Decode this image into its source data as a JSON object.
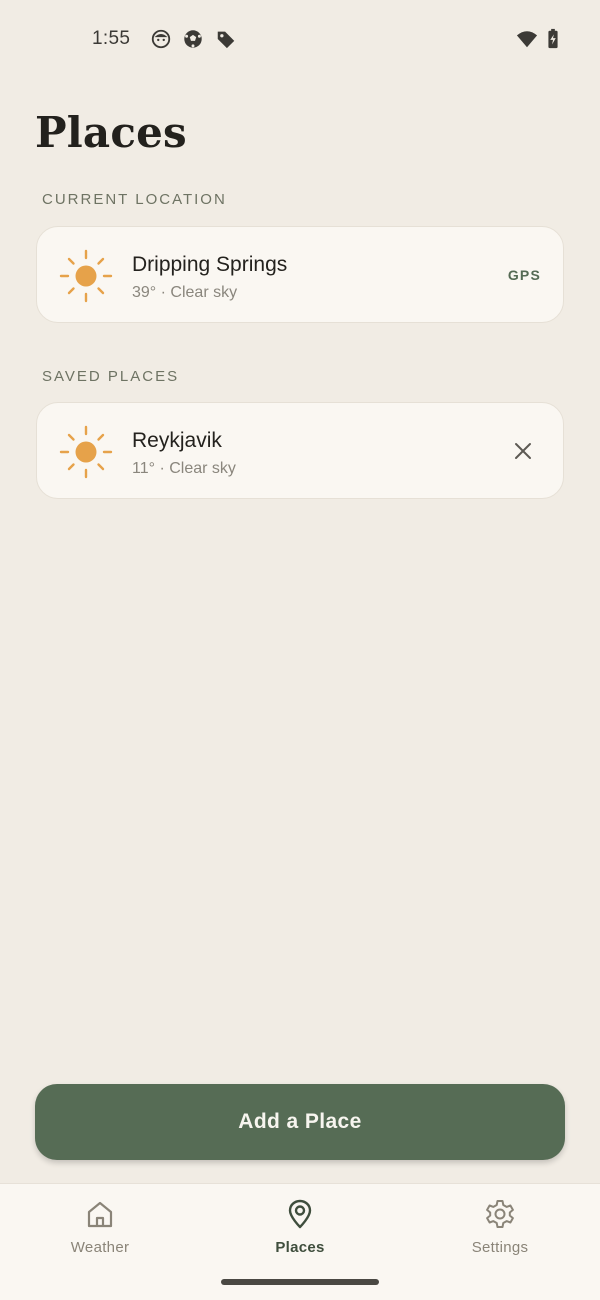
{
  "status_bar": {
    "time": "1:55",
    "left_icons": [
      "face-icon",
      "soccer-ball-icon",
      "tag-icon"
    ],
    "right_icons": [
      "wifi-icon",
      "battery-charging-icon"
    ]
  },
  "page": {
    "title": "Places"
  },
  "current_location": {
    "section_label": "CURRENT LOCATION",
    "place": {
      "name": "Dripping Springs",
      "summary": "39° · Clear sky",
      "badge": "GPS",
      "icon": "sun-icon"
    }
  },
  "saved_places": {
    "section_label": "SAVED PLACES",
    "items": [
      {
        "name": "Reykjavik",
        "summary": "11° · Clear sky",
        "icon": "sun-icon",
        "action_icon": "close-icon"
      }
    ]
  },
  "actions": {
    "add_place_label": "Add a Place"
  },
  "bottom_nav": {
    "items": [
      {
        "label": "Weather",
        "icon": "home-icon",
        "active": false
      },
      {
        "label": "Places",
        "icon": "map-pin-icon",
        "active": true
      },
      {
        "label": "Settings",
        "icon": "gear-icon",
        "active": false
      }
    ]
  },
  "colors": {
    "background": "#f1ece4",
    "card": "#faf7f2",
    "accent_green": "#566c55",
    "sun": "#e6a24a",
    "label_muted": "#6e7363"
  }
}
